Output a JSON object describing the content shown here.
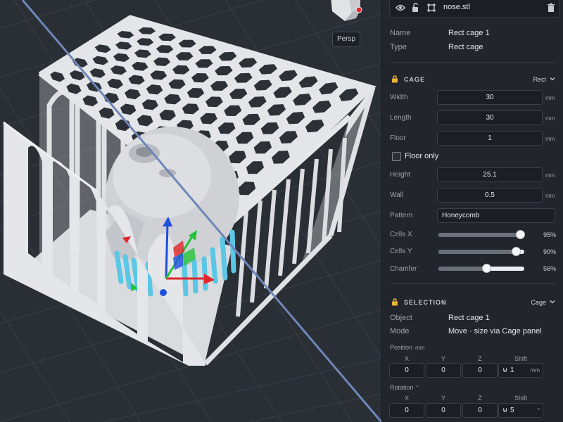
{
  "viewport": {
    "persp_button": "Persp"
  },
  "object_row": {
    "file_name": "nose.stl",
    "icons": [
      "eye-icon",
      "lock-open-icon",
      "bounding-box-icon",
      "trash-icon"
    ]
  },
  "properties": {
    "name_label": "Name",
    "name_value": "Rect cage 1",
    "type_label": "Type",
    "type_value": "Rect cage"
  },
  "cage": {
    "title": "CAGE",
    "mode": "Rect",
    "width_label": "Width",
    "width": "30",
    "width_unit": "mm",
    "length_label": "Length",
    "length": "30",
    "length_unit": "mm",
    "floor_label": "Floor",
    "floor": "1",
    "floor_unit": "mm",
    "floor_only_label": "Floor only",
    "floor_only_checked": false,
    "height_label": "Height",
    "height": "25.1",
    "height_unit": "mm",
    "wall_label": "Wall",
    "wall": "0.5",
    "wall_unit": "mm",
    "pattern_label": "Pattern",
    "pattern": "Honeycomb",
    "sliders": [
      {
        "label": "Cells X",
        "value": 0.95,
        "text": "95%"
      },
      {
        "label": "Cells Y",
        "value": 0.9,
        "text": "90%"
      },
      {
        "label": "Chamfer",
        "value": 0.56,
        "text": "56%"
      }
    ]
  },
  "selection": {
    "title": "SELECTION",
    "mode": "Cage",
    "object_label": "Object",
    "object_value": "Rect cage 1",
    "mode_label": "Mode",
    "mode_value": "Move · size via Cage panel",
    "position_label": "Position",
    "position_unit": "mm",
    "axes": [
      "X",
      "Y",
      "Z",
      "Shift"
    ],
    "position": {
      "x": "0",
      "y": "0",
      "z": "0",
      "shift_symbol": "⊌",
      "shift": "1",
      "shift_unit": "mm"
    },
    "rotation_label": "Rotation",
    "rotation_unit": "°",
    "rotation": {
      "x": "0",
      "y": "0",
      "z": "0",
      "shift_symbol": "⊌",
      "shift": "5",
      "shift_unit": "°"
    }
  },
  "colors": {
    "accent_lock": "#e8b23a",
    "gizmo_x": "#e0252b",
    "gizmo_y": "#22c33a",
    "gizmo_z": "#1f4fe0",
    "supports": "#5bc6e6"
  }
}
